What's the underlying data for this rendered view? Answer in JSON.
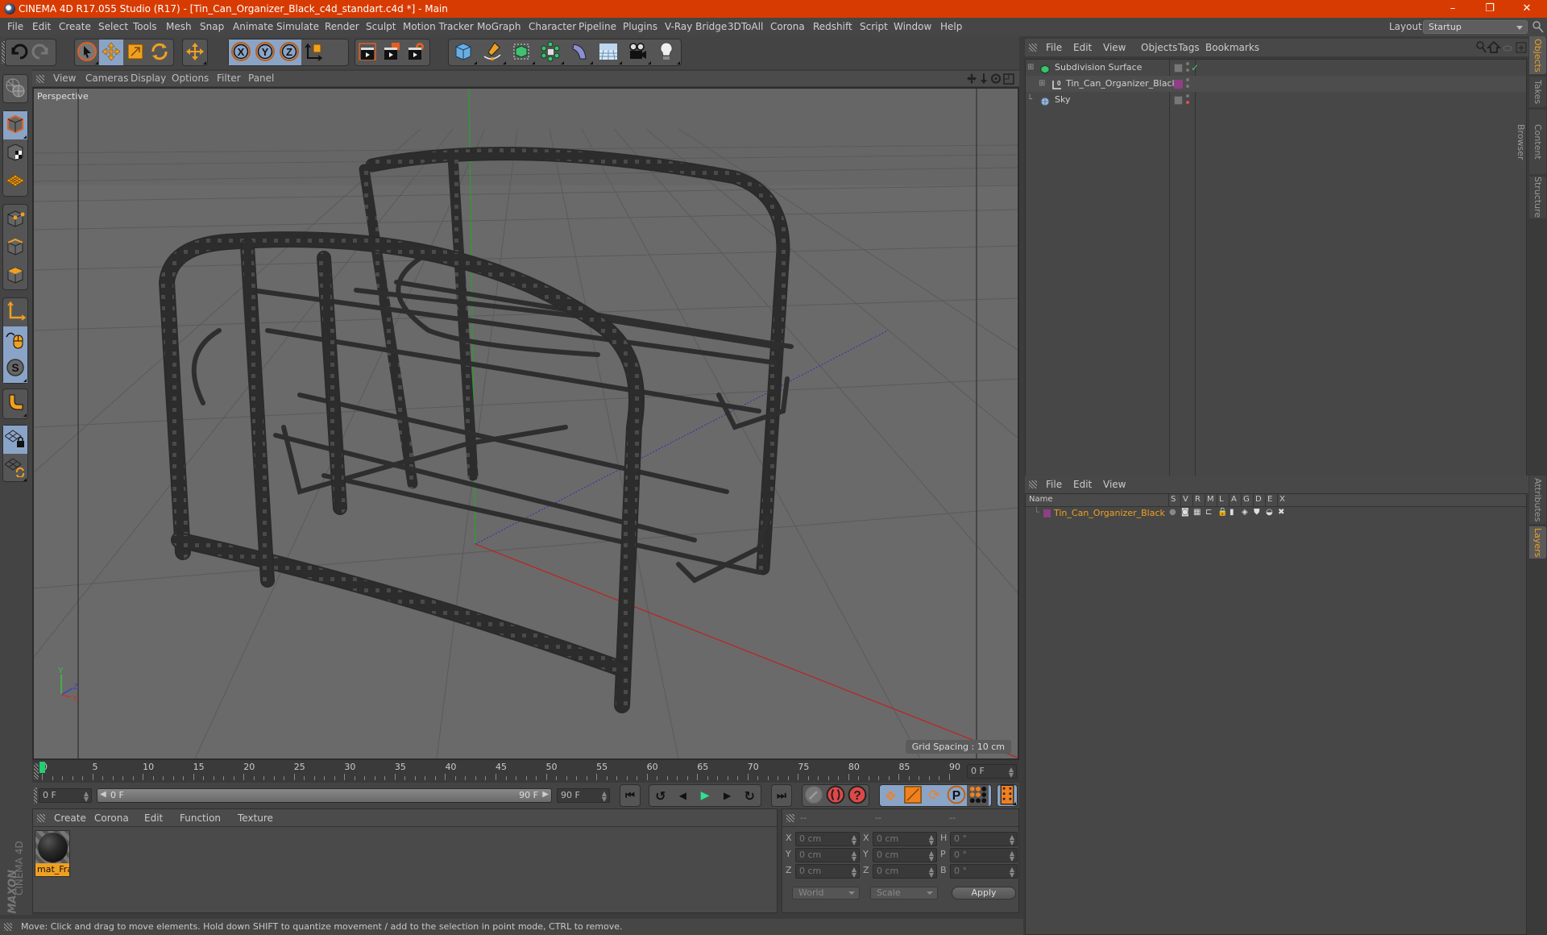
{
  "window": {
    "title": "CINEMA 4D R17.055 Studio (R17) - [Tin_Can_Organizer_Black_c4d_standart.c4d *] - Main",
    "controls": {
      "minimize": "–",
      "restore": "❐",
      "close": "✕"
    }
  },
  "menubar": {
    "items": [
      "File",
      "Edit",
      "Create",
      "Select",
      "Tools",
      "Mesh",
      "Snap",
      "Animate",
      "Simulate",
      "Render",
      "Sculpt",
      "Motion Tracker",
      "MoGraph",
      "Character",
      "Pipeline",
      "Plugins",
      "V-Ray Bridge",
      "3DToAll",
      "Corona",
      "Redshift",
      "Script",
      "Window",
      "Help"
    ],
    "layout_label": "Layout:",
    "layout_value": "Startup"
  },
  "toolbar": {
    "groups": [
      [
        "undo-icon",
        "redo-icon"
      ],
      [
        "select-live-icon",
        "move-icon",
        "scale-icon",
        "rotate-icon"
      ],
      [
        "move-tool-icon"
      ],
      [
        "x-axis-icon",
        "y-axis-icon",
        "z-axis-icon",
        "coordinate-system-icon"
      ],
      [
        "render-view-icon",
        "render-picture-viewer-icon",
        "edit-render-settings-icon"
      ],
      [
        "cube-icon",
        "pen-spline-icon",
        "subdivision-surface-icon",
        "cloner-icon",
        "deformer-icon",
        "floor-icon",
        "camera-icon",
        "light-icon"
      ]
    ]
  },
  "lefttools": {
    "items": [
      "make-editable-icon",
      "model-mode-icon",
      "texture-mode-icon",
      "workplane-mode-icon",
      "points-mode-icon",
      "edges-mode-icon",
      "polygons-mode-icon",
      "axis-icon",
      "tweak-mode-icon",
      "solo-icon",
      "snap-magnet-icon",
      "locked-workplane-icon",
      "workplane-icon"
    ]
  },
  "viewport": {
    "menu": [
      "View",
      "Cameras",
      "Display",
      "Options",
      "Filter",
      "Panel"
    ],
    "label": "Perspective",
    "grid_spacing": "Grid Spacing : 10 cm",
    "nav_icons": [
      "move-view-icon",
      "dolly-view-icon",
      "rotate-view-icon",
      "maximize-view-icon"
    ],
    "axis_labels": {
      "x": "X",
      "y": "Y",
      "z": "Z"
    }
  },
  "timeline": {
    "ticks": [
      "0",
      "5",
      "10",
      "15",
      "20",
      "25",
      "30",
      "35",
      "40",
      "45",
      "50",
      "55",
      "60",
      "65",
      "70",
      "75",
      "80",
      "85",
      "90"
    ],
    "current_frame": "0 F",
    "start_field": "0 F",
    "range_start": "0 F",
    "range_end": "90 F",
    "end_field": "90 F",
    "playhead_fraction": 0.0
  },
  "material_manager": {
    "menu": [
      "Create",
      "Corona",
      "Edit",
      "Function",
      "Texture"
    ],
    "materials": [
      {
        "name": "mat_Fra"
      }
    ]
  },
  "coordinates": {
    "headers": [
      "--",
      "--",
      "--"
    ],
    "rows": [
      {
        "a": "X",
        "av": "0 cm",
        "b": "X",
        "bv": "0 cm",
        "c": "H",
        "cv": "0 °"
      },
      {
        "a": "Y",
        "av": "0 cm",
        "b": "Y",
        "bv": "0 cm",
        "c": "P",
        "cv": "0 °"
      },
      {
        "a": "Z",
        "av": "0 cm",
        "b": "Z",
        "bv": "0 cm",
        "c": "B",
        "cv": "0 °"
      }
    ],
    "mode_select": "World",
    "type_select": "Scale",
    "apply_label": "Apply"
  },
  "brand": {
    "maxon": "MAXON",
    "product": "CINEMA 4D"
  },
  "status": "Move: Click and drag to move elements. Hold down SHIFT to quantize movement / add to the selection in point mode, CTRL to remove.",
  "object_manager": {
    "menu": [
      "File",
      "Edit",
      "View",
      "Objects",
      "Tags",
      "Bookmarks"
    ],
    "objects": [
      {
        "name": "Subdivision Surface",
        "icon": "subdivision-surface-icon",
        "check": "✓",
        "color": "#4ec36a"
      },
      {
        "name": "Tin_Can_Organizer_Black",
        "icon": "null-object-icon",
        "layer_color": "#8e3f86"
      },
      {
        "name": "Sky",
        "icon": "sky-icon",
        "dot": "#e05050"
      }
    ]
  },
  "layer_manager": {
    "menu": [
      "File",
      "Edit",
      "View"
    ],
    "columns": [
      "Name",
      "S",
      "V",
      "R",
      "M",
      "L",
      "A",
      "G",
      "D",
      "E",
      "X"
    ],
    "layers": [
      {
        "name": "Tin_Can_Organizer_Black",
        "color": "#8e3f86",
        "name_color": "#f0a020"
      }
    ]
  },
  "side_tabs": {
    "top": [
      {
        "label": "Objects",
        "active": true
      },
      {
        "label": "Takes",
        "active": false
      },
      {
        "label": "Content Browser",
        "active": false
      },
      {
        "label": "Structure",
        "active": false
      }
    ],
    "bottom": [
      {
        "label": "Attributes",
        "active": false
      },
      {
        "label": "Layers",
        "active": true
      }
    ]
  },
  "colors": {
    "titlebar": "#d83b01",
    "accent": "#f0a020",
    "selected_tool": "#8aa4c8"
  }
}
